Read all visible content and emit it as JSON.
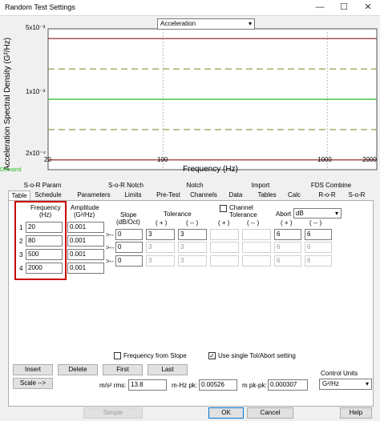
{
  "window": {
    "title": "Random Test Settings",
    "controls": [
      "—",
      "☐",
      "✕"
    ]
  },
  "plot": {
    "view_select": "Acceleration",
    "ylabel": "Acceleration Spectral Density (G²/Hz)",
    "xlabel": "Frequency (Hz)",
    "y_ticks": [
      "5x10⁻³",
      "1x10⁻³",
      "2x10⁻⁴"
    ],
    "x_ticks": [
      "20",
      "100",
      "1000",
      "2000"
    ],
    "demand_label": "Demand",
    "colors": {
      "abort": "#8b1a1a",
      "tolerance": "#9a9a4c",
      "demand": "#22bb22",
      "grid": "#bbbbbb"
    }
  },
  "chart_data": {
    "type": "line",
    "xlabel": "Frequency (Hz)",
    "ylabel": "Acceleration Spectral Density (G²/Hz)",
    "x_scale": "log",
    "y_scale": "log",
    "xlim": [
      20,
      2000
    ],
    "ylim": [
      0.0002,
      0.005
    ],
    "grid": true,
    "series": [
      {
        "name": "Demand",
        "x": [
          20,
          2000
        ],
        "y": [
          0.001,
          0.001
        ]
      },
      {
        "x": [
          20,
          2000
        ],
        "y": [
          0.002,
          0.002
        ]
      },
      {
        "x": [
          20,
          2000
        ],
        "y": [
          0.0005,
          0.0005
        ]
      },
      {
        "x": [
          20,
          2000
        ],
        "y": [
          0.004,
          0.004
        ]
      },
      {
        "x": [
          20,
          2000
        ],
        "y": [
          0.00025,
          0.00025
        ]
      }
    ]
  },
  "tabs": {
    "row1": [
      "S-o-R Param",
      "S-o-R Notch",
      "Notch",
      "Import",
      "FDS Combine"
    ],
    "row2": [
      "Table",
      "Schedule",
      "Parameters",
      "Limits",
      "Pre-Test",
      "Channels",
      "Data",
      "Tables",
      "Calc",
      "R-o-R",
      "S-o-R"
    ],
    "active": "Table"
  },
  "table": {
    "freq_header_1": "Frequency",
    "freq_header_2": "(Hz)",
    "amp_header_1": "Amplitude",
    "amp_header_2": "(G²/Hz)",
    "slope_header_1": "Slope",
    "slope_header_2": "(dB/Oct)",
    "tolerance_header": "Tolerance",
    "plus": "( + )",
    "minus": "( -- )",
    "channel_tolerance": "Channel Tolerance",
    "abort_label": "Abort",
    "abort_unit": "dB",
    "arrow": ">--",
    "rows": [
      {
        "n": "1",
        "freq": "20",
        "amp": "0.001",
        "slope": "0",
        "tol_p": "3",
        "tol_m": "3",
        "ch_p": "",
        "ch_m": "",
        "ab_p": "6",
        "ab_m": "6"
      },
      {
        "n": "2",
        "freq": "80",
        "amp": "0.001",
        "slope": "0",
        "tol_p": "3",
        "tol_m": "3",
        "ch_p": "",
        "ch_m": "",
        "ab_p": "6",
        "ab_m": "6"
      },
      {
        "n": "3",
        "freq": "500",
        "amp": "0.001",
        "slope": "0",
        "tol_p": "3",
        "tol_m": "3",
        "ch_p": "",
        "ch_m": "",
        "ab_p": "6",
        "ab_m": "6"
      },
      {
        "n": "4",
        "freq": "2000",
        "amp": "0.001"
      }
    ]
  },
  "options": {
    "freq_from_slope": "Frequency from Slope",
    "single_tol": "Use single Tol/Abort setting",
    "single_tol_checked": "✓"
  },
  "buttons": {
    "insert": "Insert",
    "delete": "Delete",
    "first": "First",
    "last": "Last",
    "scale": "Scale -->",
    "simple": "Simple",
    "ok": "OK",
    "cancel": "Cancel",
    "help": "Help"
  },
  "stats": {
    "rms_label": "m/s² rms:",
    "rms_value": "13.8",
    "pk_label": "m-Hz pk:",
    "pk_value": "0.00526",
    "pkpk_label": "m pk-pk:",
    "pkpk_value": "0.000307"
  },
  "units": {
    "label": "Control Units",
    "value": "G²/Hz"
  }
}
